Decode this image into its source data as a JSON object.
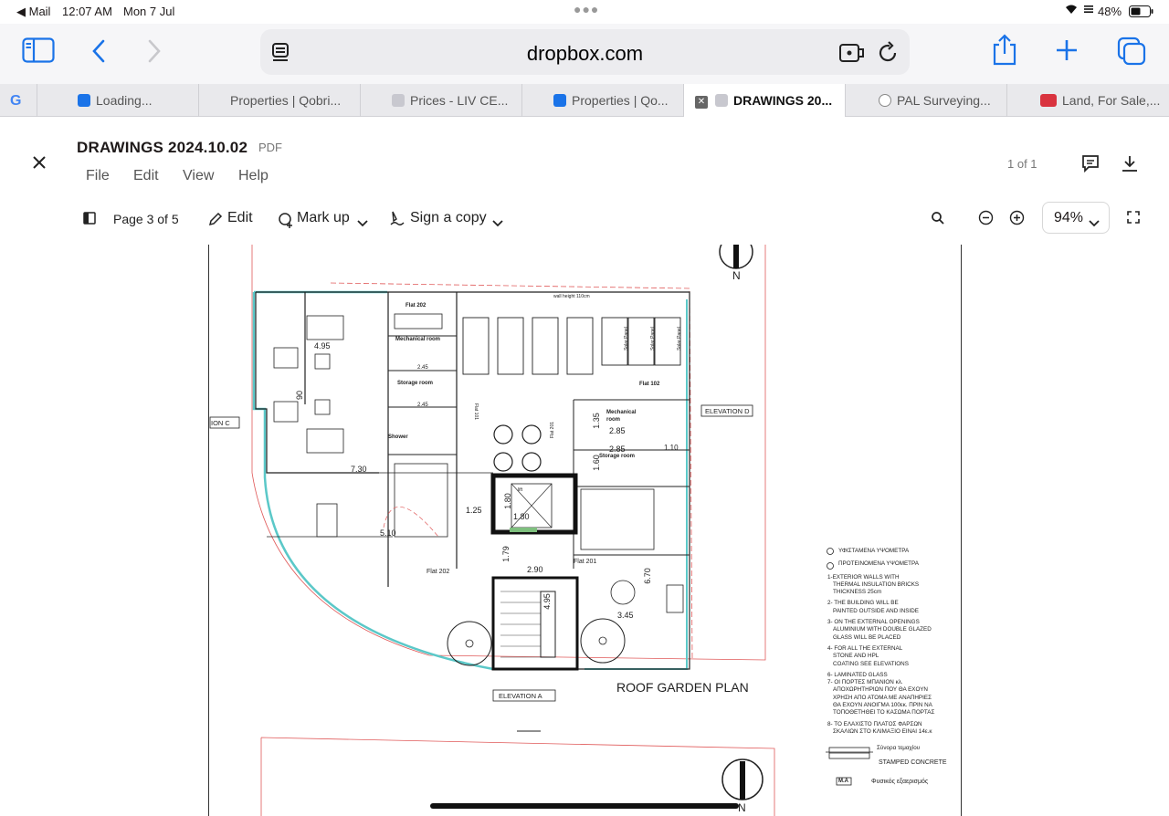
{
  "status_bar": {
    "back_app": "◀ Mail",
    "time": "12:07 AM",
    "date": "Mon 7 Jul",
    "battery": "48%"
  },
  "browser": {
    "url": "dropbox.com",
    "tabs": [
      {
        "label": "Loading...",
        "favicon_color": "#1a73e8"
      },
      {
        "label": "Properties | Qobri...",
        "favicon_color": ""
      },
      {
        "label": "Prices - LIV CE...",
        "favicon_color": "#c8c8cf"
      },
      {
        "label": "Properties | Qo...",
        "favicon_color": "#1a73e8"
      },
      {
        "label": "DRAWINGS 20...",
        "favicon_color": "#c8c8cf"
      },
      {
        "label": "PAL Surveying...",
        "favicon_color": "#888"
      },
      {
        "label": "Land, For Sale,...",
        "favicon_color": "#d9333f"
      }
    ]
  },
  "viewer": {
    "doc_title": "DRAWINGS 2024.10.02",
    "doc_type": "PDF",
    "page_count": "1 of 1",
    "menu": [
      "File",
      "Edit",
      "View",
      "Help"
    ],
    "page_indicator": "Page 3 of 5",
    "edit_label": "Edit",
    "markup_label": "Mark up",
    "sign_label": "Sign a copy",
    "zoom": "94%"
  },
  "drawing": {
    "title": "ROOF GARDEN PLAN",
    "north": "N",
    "elevation_a": "ELEVATION A",
    "elevation_c": "ION C",
    "elevation_d": "ELEVATION D",
    "rooms": {
      "flat_202_top": "Flat 202",
      "mechanical_room": "Mechanical room",
      "storage_room": "Storage room",
      "shower": "Shower",
      "flat_102": "Flat 102",
      "mechanical_room_2": "Mechanical room",
      "storage_room_2": "Storage room",
      "flat_201": "Flat 201",
      "flat_202_bottom": "Flat 202",
      "flat_101": "Flat 101",
      "flat_201_v": "Flat 201",
      "solar_panel": "Solar Panel",
      "lift": "lift",
      "wall_height": "wall height 110cm"
    },
    "dims": {
      "d495": "4.95",
      "d90": "90",
      "d730": "7.30",
      "d510": "5.10",
      "d125": "1.25",
      "d180a": "1.80",
      "d180b": "1.80",
      "d179": "1.79",
      "d290": "2.90",
      "d495v": "4.95",
      "d345": "3.45",
      "d670": "6.70",
      "d135": "1.35",
      "d285a": "2.85",
      "d285b": "2.85",
      "d160": "1.60",
      "d110": "1.10",
      "d245a": "2.45",
      "d245b": "2.45"
    },
    "legend": [
      "ΥΦΙΣΤΑΜΕΝΑ ΥΨΟΜΕΤΡΑ",
      "ΠΡΟΤΕΙΝΟΜΕΝΑ ΥΨΟΜΕΤΡΑ",
      "1-EXTERIOR WALLS WITH",
      "THERMAL INSULATION BRICKS",
      "THICKNESS 25cm",
      "2- THE BUILDING WILL BE",
      "PAINTED OUTSIDE AND INSIDE",
      "3- ON THE EXTERNAL OPENINGS",
      "ALUMINIUM WITH DOUBLE GLAZED",
      "GLASS WILL BE PLACED",
      "4- FOR ALL THE EXTERNAL",
      "STONE AND HPL",
      "COATING SEE ELEVATIONS",
      "6-          LAMINATED GLASS",
      "7- ΟΙ ΠΟΡΤΕΣ ΜΠΑΝΙΟΝ κλ.",
      "ΑΠΟΧΩΡΗΤΗΡΙΩΝ ΠΟΥ ΘΑ ΕΧΟΥΝ",
      "ΧΡΗΣΗ ΑΠΟ ΑΤΟΜΑ ΜΕ ΑΝΑΠΗΡΙΕΣ",
      "ΘΑ ΕΧΟΥΝ ΑΝΟΙΓΜΑ 100εκ. ΠΡΙΝ ΝΑ",
      "ΤΟΠΟΘΕΤΗΘΕΙ ΤΟ ΚΑΣΩΜΑ ΠΟΡΤΑΣ",
      "8- ΤΟ ΕΛΑΧΙΣΤΟ ΠΛΑΤΟΣ ΦΑΡΣΩΝ",
      "ΣΚΑΛΙΩΝ ΣΤΟ ΚΛΙΜΑΞΙΟ ΕΙΝΑΙ 14ε.κ",
      "Σύνορα τεμαχίου",
      "STAMPED CONCRETE",
      "M.A",
      "Φυσικός εξαερισμός"
    ]
  }
}
